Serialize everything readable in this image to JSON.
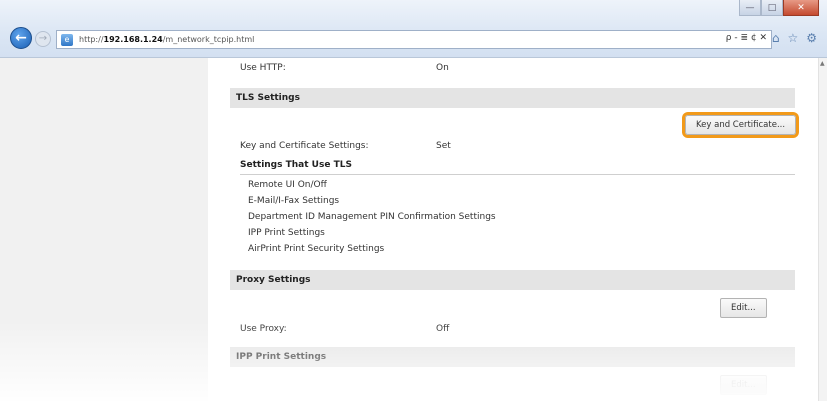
{
  "browser": {
    "url_prefix": "http://",
    "url_host": "192.168.1.24",
    "url_path": "/m_network_tcpip.html",
    "address_tools": "ρ - ≣ ¢ ✕",
    "window": {
      "minimize": "—",
      "maximize": "□",
      "close": "✕"
    }
  },
  "top": {
    "use_http_label": "Use HTTP:",
    "use_http_value": "On"
  },
  "tls": {
    "heading": "TLS Settings",
    "button": "Key and Certificate...",
    "kc_label": "Key and Certificate Settings:",
    "kc_value": "Set",
    "subheading": "Settings That Use TLS",
    "items": [
      "Remote UI On/Off",
      "E-Mail/I-Fax Settings",
      "Department ID Management PIN Confirmation Settings",
      "IPP Print Settings",
      "AirPrint Print Security Settings"
    ]
  },
  "proxy": {
    "heading": "Proxy Settings",
    "button": "Edit...",
    "use_label": "Use Proxy:",
    "use_value": "Off"
  },
  "ipp": {
    "heading": "IPP Print Settings",
    "button": "Edit..."
  },
  "colors": {
    "highlight": "#f29a1a",
    "section_bg": "#e4e4e4"
  }
}
